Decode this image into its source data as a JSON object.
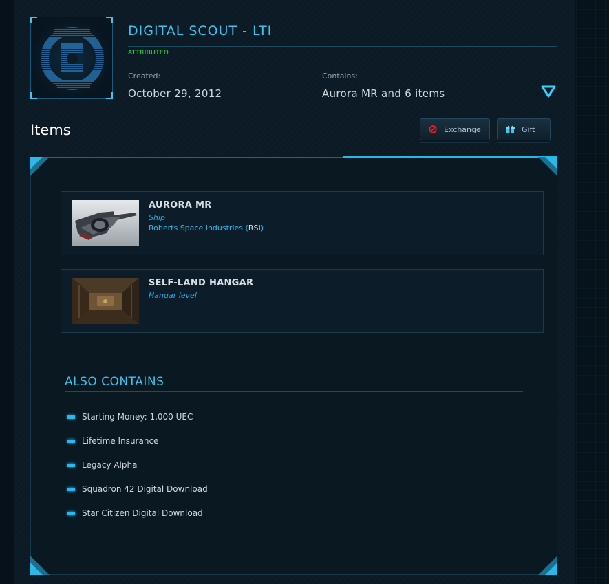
{
  "pledge": {
    "title": "DIGITAL SCOUT - LTI",
    "status": "ATTRIBUTED",
    "created_label": "Created:",
    "created_value": "October 29, 2012",
    "contains_label": "Contains:",
    "contains_value": "Aurora MR and 6 items"
  },
  "items_section": {
    "title": "Items",
    "buttons": {
      "exchange": "Exchange",
      "gift": "Gift"
    }
  },
  "items": [
    {
      "name": "AURORA MR",
      "type": "Ship",
      "manufacturer": "Roberts Space Industries",
      "manufacturer_code": "RSI"
    },
    {
      "name": "SELF-LAND HANGAR",
      "type": "Hangar level"
    }
  ],
  "also_contains": {
    "title": "ALSO CONTAINS",
    "entries": [
      "Starting Money: 1,000 UEC",
      "Lifetime Insurance",
      "Legacy Alpha",
      "Squadron 42 Digital Download",
      "Star Citizen Digital Download"
    ]
  },
  "colors": {
    "accent": "#3fc3ef",
    "status_green": "#2ee042",
    "exchange_icon": "#e8202a",
    "gift_icon": "#3fc3ef"
  },
  "icons": {
    "toggle": "chevron-down-triangle-icon",
    "exchange": "no-entry-icon",
    "gift": "gift-box-icon"
  }
}
